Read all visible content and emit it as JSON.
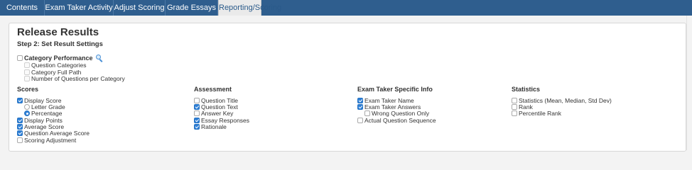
{
  "tabs": [
    {
      "label": "Contents",
      "active": false
    },
    {
      "label": "Exam Taker Activity",
      "active": false
    },
    {
      "label": "Adjust Scoring",
      "active": false
    },
    {
      "label": "Grade Essays",
      "active": false
    },
    {
      "label": "Reporting/Scoring",
      "active": true
    }
  ],
  "page": {
    "title": "Release Results",
    "step_title": "Step 2: Set Result Settings"
  },
  "category_performance": {
    "label": "Category Performance",
    "checked": false,
    "info_icon": "magnifier-icon",
    "children": [
      {
        "label": "Question Categories",
        "checked": false,
        "disabled": true
      },
      {
        "label": "Category Full Path",
        "checked": false,
        "disabled": true
      },
      {
        "label": "Number of Questions per Category",
        "checked": false,
        "disabled": true
      }
    ]
  },
  "sections": {
    "scores": {
      "title": "Scores",
      "options": [
        {
          "label": "Display Score",
          "checked": true
        },
        {
          "label": "Letter Grade",
          "checked": false,
          "kind": "radio",
          "indent": true
        },
        {
          "label": "Percentage",
          "checked": true,
          "kind": "radio",
          "indent": true
        },
        {
          "label": "Display Points",
          "checked": true
        },
        {
          "label": "Average Score",
          "checked": true
        },
        {
          "label": "Question Average Score",
          "checked": true
        },
        {
          "label": "Scoring Adjustment",
          "checked": false
        }
      ]
    },
    "assessment": {
      "title": "Assessment",
      "options": [
        {
          "label": "Question Title",
          "checked": false
        },
        {
          "label": "Question Text",
          "checked": true
        },
        {
          "label": "Answer Key",
          "checked": false
        },
        {
          "label": "Essay Responses",
          "checked": true
        },
        {
          "label": "Rationale",
          "checked": true
        }
      ]
    },
    "exam_taker": {
      "title": "Exam Taker Specific Info",
      "options": [
        {
          "label": "Exam Taker Name",
          "checked": true
        },
        {
          "label": "Exam Taker Answers",
          "checked": true
        },
        {
          "label": "Wrong Question Only",
          "checked": false,
          "indent": true
        },
        {
          "label": "Actual Question Sequence",
          "checked": false
        }
      ]
    },
    "statistics": {
      "title": "Statistics",
      "options": [
        {
          "label": "Statistics (Mean, Median, Std Dev)",
          "checked": false
        },
        {
          "label": "Rank",
          "checked": false
        },
        {
          "label": "Percentile Rank",
          "checked": false
        }
      ]
    }
  },
  "colors": {
    "tab_bar": "#2f5e8e",
    "checkbox_checked": "#2f7fd6",
    "panel_bg": "#ffffff",
    "page_bg": "#f3f3f3"
  }
}
